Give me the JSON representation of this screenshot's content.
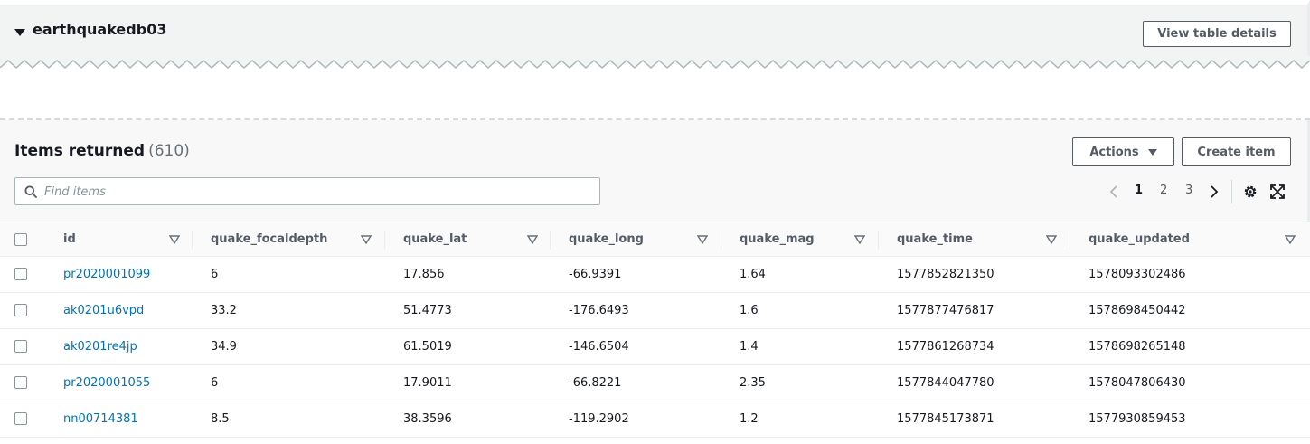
{
  "table_section": {
    "name": "earthquakedb03",
    "view_details_label": "View table details"
  },
  "items": {
    "title": "Items returned",
    "count": "(610)",
    "actions_label": "Actions",
    "create_label": "Create item",
    "search_placeholder": "Find items",
    "pages": [
      "1",
      "2",
      "3"
    ],
    "current_page": "1"
  },
  "icons": {
    "caret": "caret-down-icon",
    "search": "search-icon",
    "prev": "chevron-left-icon",
    "next": "chevron-right-icon",
    "settings": "gear-icon",
    "fullscreen": "expand-icon",
    "sort": "sort-triangle-icon"
  },
  "colors": {
    "link": "#0073bb",
    "panel": "#f2f3f3",
    "text": "#16191f",
    "muted": "#545b64"
  },
  "columns": [
    "id",
    "quake_focaldepth",
    "quake_lat",
    "quake_long",
    "quake_mag",
    "quake_time",
    "quake_updated"
  ],
  "rows": [
    [
      "pr2020001099",
      "6",
      "17.856",
      "-66.9391",
      "1.64",
      "1577852821350",
      "1578093302486"
    ],
    [
      "ak0201u6vpd",
      "33.2",
      "51.4773",
      "-176.6493",
      "1.6",
      "1577877476817",
      "1578698450442"
    ],
    [
      "ak0201re4jp",
      "34.9",
      "61.5019",
      "-146.6504",
      "1.4",
      "1577861268734",
      "1578698265148"
    ],
    [
      "pr2020001055",
      "6",
      "17.9011",
      "-66.8221",
      "2.35",
      "1577844047780",
      "1578047806430"
    ],
    [
      "nn00714381",
      "8.5",
      "38.3596",
      "-119.2902",
      "1.2",
      "1577845173871",
      "1577930859453"
    ]
  ]
}
